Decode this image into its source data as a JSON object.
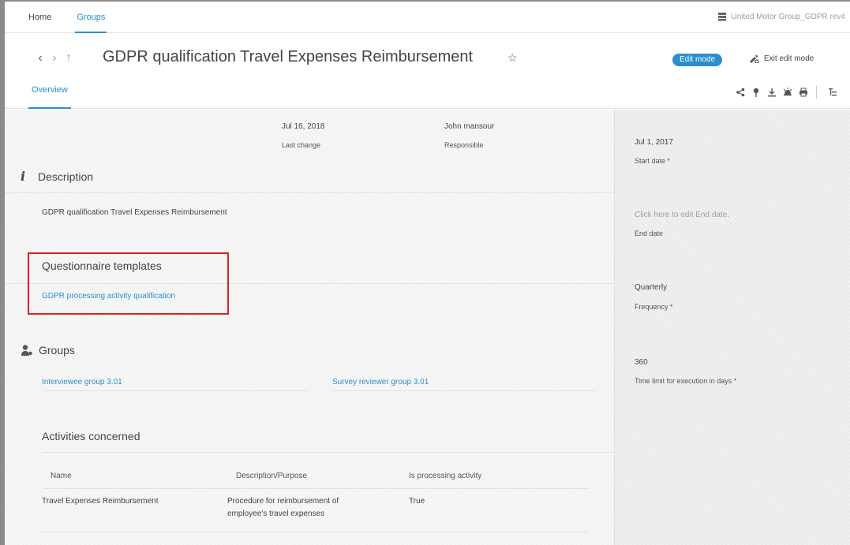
{
  "topnav": {
    "home": "Home",
    "groups": "Groups"
  },
  "database": {
    "name": "United Motor Group_GDPR rev4",
    "icon": "database-icon"
  },
  "title": {
    "text": "GDPR qualification Travel Expenses Reimbursement"
  },
  "header": {
    "edit_mode": "Edit mode",
    "exit_edit_mode": "Exit edit mode"
  },
  "tabs": {
    "overview": "Overview"
  },
  "meta": {
    "last_change_value": "Jul 16, 2018",
    "last_change_label": "Last change",
    "responsible_value": "John mansour",
    "responsible_label": "Responsible"
  },
  "description": {
    "heading": "Description",
    "text": "GDPR qualification Travel Expenses Reimbursement"
  },
  "questionnaire": {
    "heading": "Questionnaire templates",
    "link": "GDPR processing activity qualification"
  },
  "groups": {
    "heading": "Groups",
    "items": [
      "Interviewee group 3.01",
      "Survey reviewer group 3.01"
    ]
  },
  "activities": {
    "heading": "Activities concerned",
    "columns": [
      "Name",
      "Description/Purpose",
      "Is processing activity"
    ],
    "rows": [
      {
        "name": "Travel Expenses Reimbursement",
        "description_line1": "Procedure for reimbursement of",
        "description_line2": "employee's travel expenses",
        "is_processing": "True"
      }
    ]
  },
  "side": {
    "start_date_value": "Jul 1, 2017",
    "start_date_label": "Start date *",
    "end_date_hint": "Click here to edit End date.",
    "end_date_label": "End date",
    "frequency_value": "Quarterly",
    "frequency_label": "Frequency *",
    "time_limit_value": "360",
    "time_limit_label": "Time limit for execution in days *"
  },
  "colors": {
    "accent": "#2a8fd0",
    "highlight": "#e02020"
  }
}
